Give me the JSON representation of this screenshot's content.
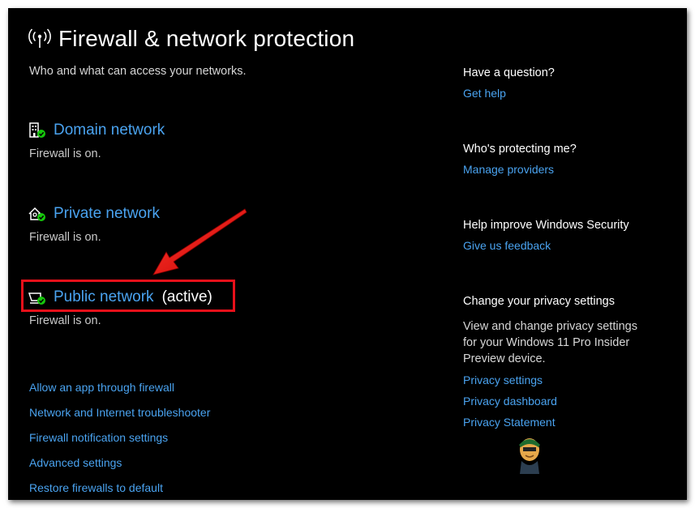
{
  "page": {
    "title": "Firewall & network protection",
    "subtitle": "Who and what can access your networks.",
    "title_icon": "wifi-signal-icon"
  },
  "networks": [
    {
      "label": "Domain network",
      "status": "Firewall is on.",
      "icon": "domain-network-icon",
      "active_label": ""
    },
    {
      "label": "Private network",
      "status": "Firewall is on.",
      "icon": "private-network-icon",
      "active_label": ""
    },
    {
      "label": "Public network",
      "status": "Firewall is on.",
      "icon": "public-network-icon",
      "active_label": "(active)"
    }
  ],
  "links": [
    "Allow an app through firewall",
    "Network and Internet troubleshooter",
    "Firewall notification settings",
    "Advanced settings",
    "Restore firewalls to default"
  ],
  "sidebar": {
    "question": {
      "heading": "Have a question?",
      "link": "Get help"
    },
    "protecting": {
      "heading": "Who's protecting me?",
      "link": "Manage providers"
    },
    "improve": {
      "heading": "Help improve Windows Security",
      "link": "Give us feedback"
    },
    "privacy": {
      "heading": "Change your privacy settings",
      "text": "View and change privacy settings for your Windows 11 Pro Insider Preview device.",
      "links": [
        "Privacy settings",
        "Privacy dashboard",
        "Privacy Statement"
      ]
    }
  },
  "colors": {
    "background": "#000000",
    "link": "#4aa3f0",
    "status_ok": "#16c60c",
    "annotation": "#e8101a"
  }
}
